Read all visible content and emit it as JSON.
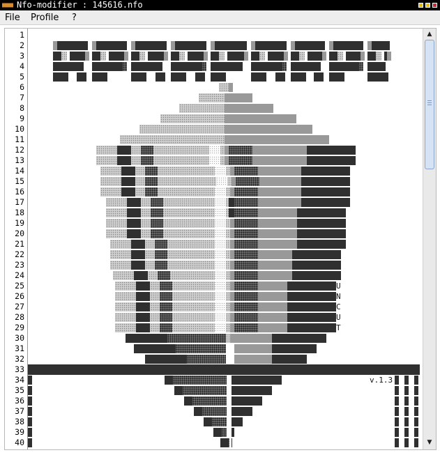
{
  "window": {
    "title": "Nfo-modifier : 145616.nfo",
    "title_buttons": [
      "minimize",
      "maximize",
      "close"
    ]
  },
  "menu": {
    "items": [
      {
        "label": "File"
      },
      {
        "label": "Profile"
      },
      {
        "label": "?"
      }
    ]
  },
  "editor": {
    "line_numbers": [
      "1",
      "2",
      "3",
      "4",
      "5",
      "6",
      "7",
      "8",
      "9",
      "10",
      "11",
      "12",
      "13",
      "14",
      "15",
      "16",
      "17",
      "18",
      "19",
      "20",
      "21",
      "22",
      "23",
      "24",
      "25",
      "26",
      "27",
      "28",
      "29",
      "30",
      "31",
      "32",
      "33",
      "34",
      "35",
      "36",
      "37",
      "38",
      "39",
      "40"
    ],
    "side_letters": [
      "U",
      "N",
      "C",
      "U",
      "T"
    ],
    "version": "v.1.3"
  },
  "colors": {
    "titlebar_bg": "#000000",
    "menubar_bg": "#ededed",
    "scroll_thumb": "#d6e3f4",
    "scroll_thumb_border": "#8aa5cc",
    "solid_block": "#303030",
    "medium_shade": "#999999"
  },
  "icons": {
    "window_icon": "dots-icon",
    "scroll_up": "arrow-up-icon",
    "scroll_down": "arrow-down-icon"
  }
}
